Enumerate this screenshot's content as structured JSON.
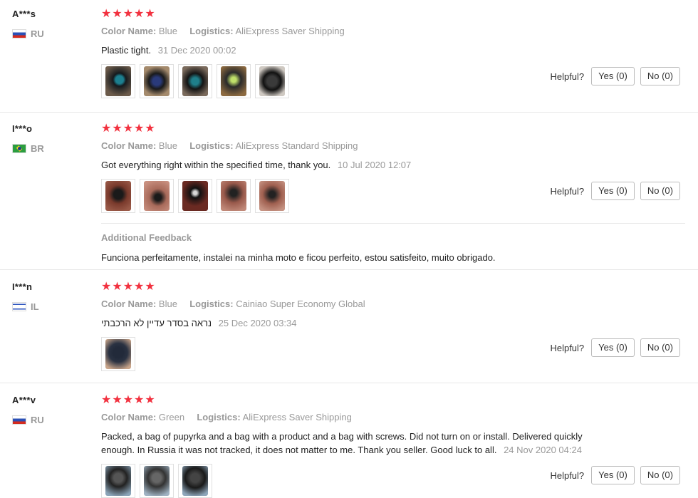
{
  "labels": {
    "color_name": "Color Name:",
    "logistics": "Logistics:",
    "helpful": "Helpful?",
    "additional_feedback": "Additional Feedback"
  },
  "stars_glyph": "★★★★★",
  "reviews": [
    {
      "user": "A***s",
      "country": "RU",
      "rating": 5,
      "color": "Blue",
      "logistics": "AliExpress Saver Shipping",
      "text": "Plastic tight.",
      "date": "31 Dec 2020 00:02",
      "yes": "Yes (0)",
      "no": "No (0)"
    },
    {
      "user": "I***o",
      "country": "BR",
      "rating": 5,
      "color": "Blue",
      "logistics": "AliExpress Standard Shipping",
      "text": "Got everything right within the specified time, thank you.",
      "date": "10 Jul 2020 12:07",
      "yes": "Yes (0)",
      "no": "No (0)",
      "additional_feedback": "Funciona perfeitamente, instalei na minha moto e ficou perfeito, estou satisfeito, muito obrigado."
    },
    {
      "user": "I***n",
      "country": "IL",
      "rating": 5,
      "color": "Blue",
      "logistics": "Cainiao Super Economy Global",
      "text": "נראה בסדר עדיין לא הרכבתי",
      "date": "25 Dec 2020 03:34",
      "yes": "Yes (0)",
      "no": "No (0)"
    },
    {
      "user": "A***v",
      "country": "RU",
      "rating": 5,
      "color": "Green",
      "logistics": "AliExpress Saver Shipping",
      "text": "Packed, a bag of pupyrka and a bag with a product and a bag with screws. Did not turn on or install. Delivered quickly enough. In Russia it was not tracked, it does not matter to me. Thank you seller. Good luck to all.",
      "date": "24 Nov 2020 04:24",
      "yes": "Yes (0)",
      "no": "No (0)"
    }
  ],
  "colors": {
    "star": "#f2313f",
    "muted": "#999999",
    "border": "#e8e8e8"
  }
}
